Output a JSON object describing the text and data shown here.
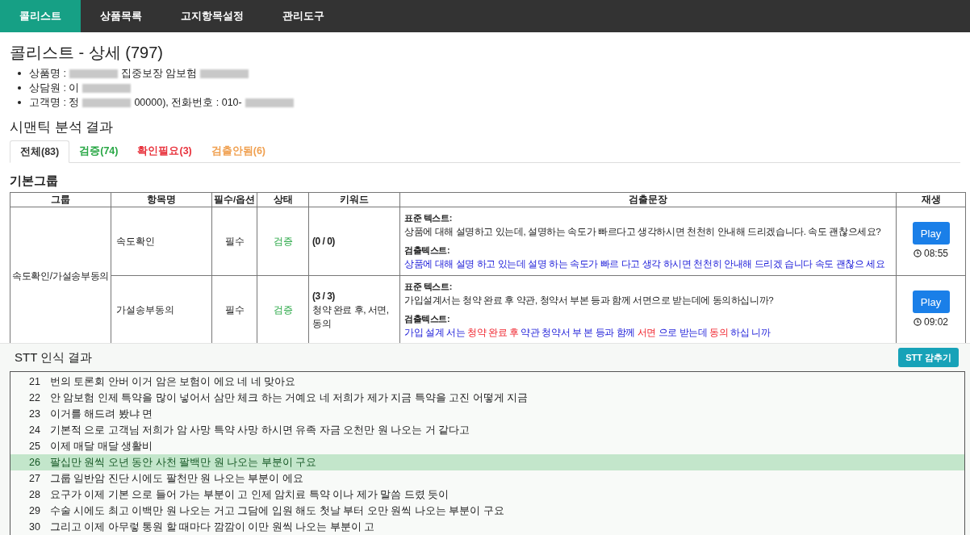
{
  "nav": [
    {
      "label": "콜리스트",
      "selected": true
    },
    {
      "label": "상품목록",
      "selected": false
    },
    {
      "label": "고지항목설정",
      "selected": false
    },
    {
      "label": "관리도구",
      "selected": false
    }
  ],
  "title": "콜리스트 - 상세 (797)",
  "info": [
    {
      "parts": [
        {
          "kind": "text",
          "text": "상품명 :"
        },
        {
          "kind": "redacted"
        },
        {
          "kind": "text",
          "text": "집중보장 암보험"
        },
        {
          "kind": "redacted"
        }
      ]
    },
    {
      "parts": [
        {
          "kind": "text",
          "text": "상담원 : 이"
        },
        {
          "kind": "redacted"
        }
      ]
    },
    {
      "parts": [
        {
          "kind": "text",
          "text": "고객명 : 정"
        },
        {
          "kind": "redacted"
        },
        {
          "kind": "text",
          "text": "00000), 전화번호 : 010-"
        },
        {
          "kind": "redacted"
        }
      ]
    }
  ],
  "section_title": "시맨틱 분석 결과",
  "tabs": [
    {
      "label": "전체(83)",
      "kind": "all",
      "selected": true
    },
    {
      "label": "검증(74)",
      "kind": "verified",
      "selected": false
    },
    {
      "label": "확인필요(3)",
      "kind": "review",
      "selected": false
    },
    {
      "label": "검출안됨(6)",
      "kind": "missing",
      "selected": false
    }
  ],
  "group_title": "기본그룹",
  "table": {
    "columns": [
      "그룹",
      "항목명",
      "필수/옵션",
      "상태",
      "키워드",
      "검출문장",
      "재생"
    ],
    "groups": [
      {
        "name": "속도확인/가설송부동의",
        "rows": [
          {
            "item": "속도확인",
            "required": "필수",
            "status": "검증",
            "color": "#28a745",
            "keyword_count": "(0 / 0)",
            "standard_label": "표준 텍스트:",
            "standard_text": "상품에 대해 설명하고 있는데, 설명하는 속도가 빠르다고 생각하시면 천천히 안내해 드리겠습니다. 속도 괜찮으세요?",
            "detected_label": "검출텍스트:",
            "detected": [
              {
                "text": "상품에 대해 설명 하고 있는데 설명 하는 속도가 빠르 다고 생각 하시면 천천히 안내해 드리겠 습니다 속도 괜찮으 세요",
                "matched": false
              }
            ],
            "play_label": "Play",
            "time": "08:55"
          },
          {
            "item": "가설송부동의",
            "required": "필수",
            "status": "검증",
            "color": "#28a745",
            "keyword_count": "(3 / 3)",
            "keywords": "청약 완료 후, 서면, 동의",
            "standard_label": "표준 텍스트:",
            "standard_text": "가입설계서는 청약 완료 후 약관, 청약서 부본 등과 함께 서면으로 받는데에 동의하십니까?",
            "detected_label": "검출텍스트:",
            "detected": [
              {
                "text": "가입 설계 서는",
                "matched": false
              },
              {
                "text": "청약 완료 후",
                "matched": true
              },
              {
                "text": "약관 청약서 부 본 등과 함께",
                "matched": false
              },
              {
                "text": "서면",
                "matched": true
              },
              {
                "text": "으로 받는데",
                "matched": false
              },
              {
                "text": "동의",
                "matched": true
              },
              {
                "text": "하십 니까",
                "matched": false
              }
            ],
            "play_label": "Play",
            "time": "09:02"
          }
        ]
      }
    ]
  },
  "stt": {
    "title": "STT 인식 결과",
    "hide_button": "STT 감추기",
    "lines": [
      {
        "number": "21",
        "text": "번의 토론회 안버 이거 암은 보험이 에요 네 네 맞아요",
        "selected": false
      },
      {
        "number": "22",
        "text": "안 암보험 인제 특약을 많이 넣어서 삼만 체크 하는 거예요 네 저희가 제가 지금 특약을 고진 어떻게 지금",
        "selected": false
      },
      {
        "number": "23",
        "text": "이거를 해드려 봤냐 면",
        "selected": false
      },
      {
        "number": "24",
        "text": "기본적 으로 고객님 저희가 암 사망 특약 사망 하시면 유족 자금 오천만 원 나오는 거 같다고",
        "selected": false
      },
      {
        "number": "25",
        "text": "이제 매달 매달 생활비",
        "selected": false
      },
      {
        "number": "26",
        "text": "팔십만 원씩 오년 동안 사천 팔백만 원 나오는 부분이 구요",
        "selected": true
      },
      {
        "number": "27",
        "text": "그룹 일반암 진단 시에도 팔천만 원 나오는 부분이 에요",
        "selected": false
      },
      {
        "number": "28",
        "text": "요구가 이제 기본 으로 들어 가는 부분이 고 인제 암치료 특약 이나 제가 말씀 드렸 듯이",
        "selected": false
      },
      {
        "number": "29",
        "text": "수술 시에도 최고 이백만 원 나오는 거고 그담에 입원 해도 첫날 부터 오만 원씩 나오는 부분이 구요",
        "selected": false
      },
      {
        "number": "30",
        "text": "그리고 이제 아무렇 통원 할 때마다 깜깜이 이만 원씩 나오는 부분이 고",
        "selected": false
      }
    ]
  }
}
